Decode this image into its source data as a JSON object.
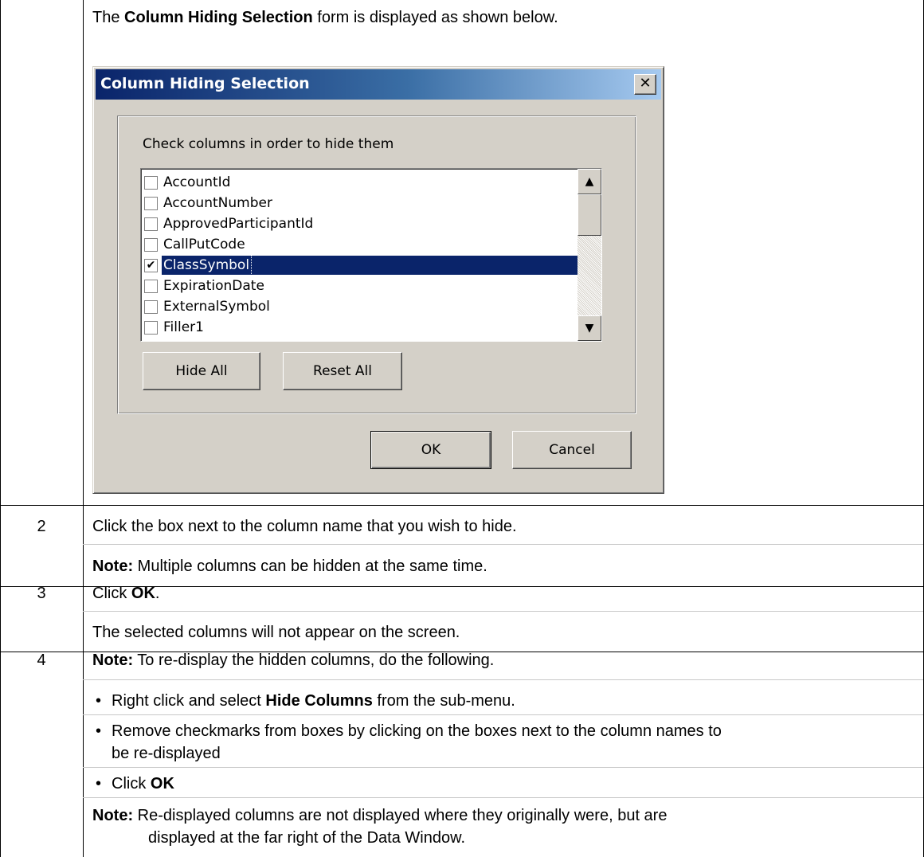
{
  "intro": {
    "prefix": "The ",
    "bold": "Column Hiding Selection",
    "suffix": " form is displayed as shown below."
  },
  "dialog": {
    "title": "Column Hiding Selection",
    "close_glyph": "✕",
    "instruction": "Check columns in order to hide them",
    "items": [
      {
        "label": "AccountId",
        "checked": false
      },
      {
        "label": "AccountNumber",
        "checked": false
      },
      {
        "label": "ApprovedParticipantId",
        "checked": false
      },
      {
        "label": "CallPutCode",
        "checked": false
      },
      {
        "label": "ClassSymbol",
        "checked": true
      },
      {
        "label": "ExpirationDate",
        "checked": false
      },
      {
        "label": "ExternalSymbol",
        "checked": false
      },
      {
        "label": "Filler1",
        "checked": false
      }
    ],
    "check_glyph": "✔",
    "scroll_up_glyph": "▲",
    "scroll_down_glyph": "▼",
    "hide_all_label": "Hide All",
    "reset_all_label": "Reset All",
    "ok_label": "OK",
    "cancel_label": "Cancel"
  },
  "steps": [
    {
      "number": "2",
      "line1": "Click the box next to the column name that you wish to hide.",
      "note_label": "Note:",
      "note_text": " Multiple columns can be hidden at the same time."
    },
    {
      "number": "3",
      "line1_prefix": "Click ",
      "line1_bold": "OK",
      "line1_suffix": ".",
      "line2": "The selected columns will not appear on the screen."
    },
    {
      "number": "4",
      "note_label": "Note:",
      "note_text": " To re-display the hidden columns, do the following.",
      "bullet": "•",
      "bullet1_prefix": "Right click and select ",
      "bullet1_bold": "Hide Columns",
      "bullet1_suffix": " from the sub-menu.",
      "bullet2_line1": "Remove checkmarks from boxes by clicking on the boxes next to the column names to",
      "bullet2_line2": "be re-displayed",
      "bullet3_prefix": "Click ",
      "bullet3_bold": "OK",
      "note2_label": "Note:",
      "note2_line1": " Re-displayed columns are not displayed where they originally were, but are",
      "note2_line2": "displayed at the far right of the Data Window."
    }
  ]
}
